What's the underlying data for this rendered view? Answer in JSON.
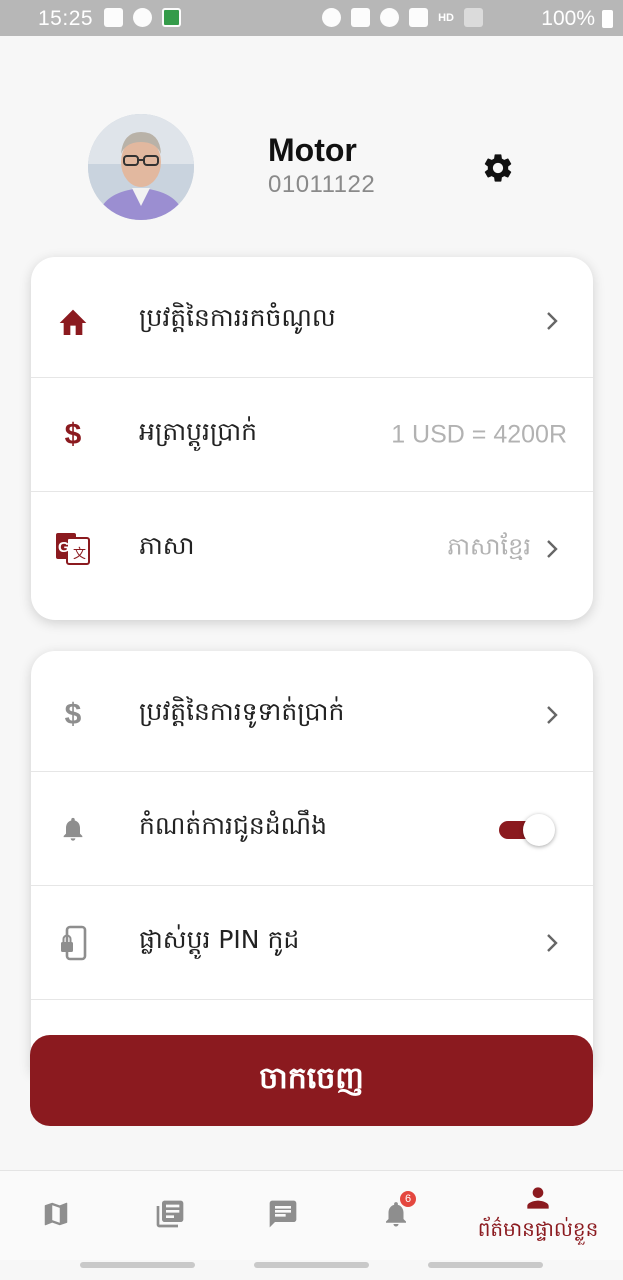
{
  "status_bar": {
    "time": "15:25",
    "network": "HD",
    "battery": "100%",
    "left_icons": [
      "gallery-icon",
      "messenger-icon",
      "app-notification-icon"
    ],
    "right_icons": [
      "alarm-icon",
      "mute-icon",
      "location-icon",
      "wifi-icon",
      "signal-icon",
      "battery-icon"
    ]
  },
  "profile": {
    "name": "Motor",
    "phone": "01011122"
  },
  "card1": {
    "rows": [
      {
        "label": "ប្រវត្តិនៃការរកចំណូល",
        "icon": "home-icon"
      },
      {
        "label": "អត្រាប្តូរប្រាក់",
        "value": "1 USD = 4200R",
        "icon": "dollar-icon"
      },
      {
        "label": "ភាសា",
        "value": "ភាសាខ្មែរ",
        "icon": "translate-icon"
      }
    ]
  },
  "card2": {
    "rows": [
      {
        "label": "ប្រវត្តិនៃការទូទាត់ប្រាក់",
        "icon": "dollar-icon"
      },
      {
        "label": "កំណត់ការជូនដំណឹង",
        "icon": "bell-icon",
        "toggle_on": true
      },
      {
        "label": "ផ្លាស់ប្តូរ PIN កូដ",
        "icon": "phone-lock-icon"
      }
    ]
  },
  "logout": {
    "label": "ចាកចេញ"
  },
  "bottom_nav": {
    "items": [
      {
        "icon": "map-icon"
      },
      {
        "icon": "list-icon"
      },
      {
        "icon": "message-icon"
      },
      {
        "icon": "bell-icon",
        "badge": "6"
      },
      {
        "icon": "person-icon",
        "label": "ព័ត៌មានផ្ទាល់ខ្លួន",
        "active": true
      }
    ]
  },
  "colors": {
    "accent": "#8b1a1f",
    "inactive_icon": "#8e8e8e",
    "muted_text": "#b2b2b2",
    "badge": "#e4473f"
  }
}
